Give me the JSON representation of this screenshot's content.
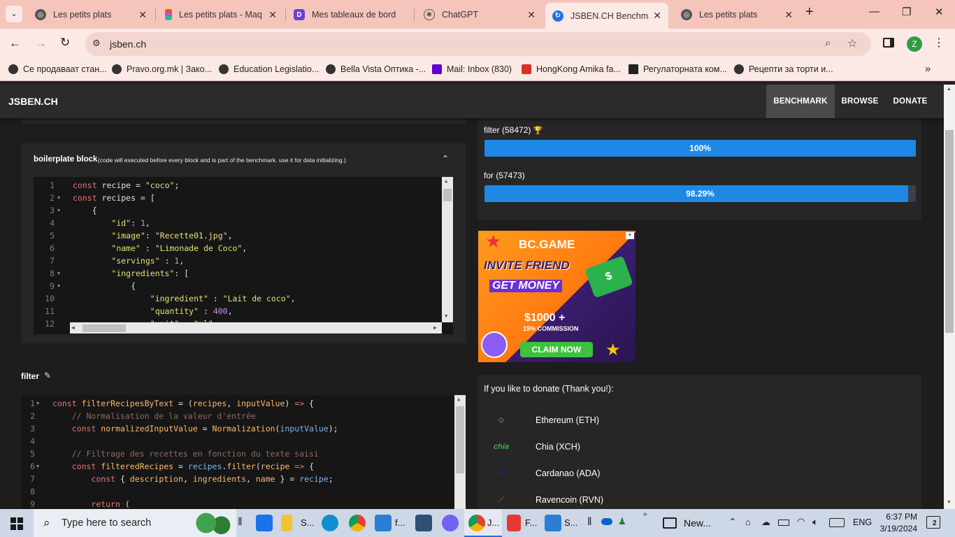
{
  "tabs": [
    {
      "title": "Les petits plats",
      "icon": "globe-icon"
    },
    {
      "title": "Les petits plats - Maq",
      "icon": "figma-icon"
    },
    {
      "title": "Mes tableaux de bord",
      "icon": "dashboard-icon"
    },
    {
      "title": "ChatGPT",
      "icon": "chatgpt-icon"
    },
    {
      "title": "JSBEN.CH Benchmark",
      "icon": "jsben-icon"
    },
    {
      "title": "Les petits plats",
      "icon": "globe-icon"
    }
  ],
  "address": "jsben.ch",
  "profile_initial": "Z",
  "bookmarks": [
    "Се продаваат стан...",
    "Pravo.org.mk | Зако...",
    "Education Legislatio...",
    "Bella Vista Оптика -...",
    "Mail: Inbox (830)",
    "HongKong Amika fa...",
    "Регулаторната ком...",
    "Рецепти за торти и..."
  ],
  "site": {
    "brand": "JSBEN.CH",
    "nav": [
      "BENCHMARK",
      "BROWSE",
      "DONATE"
    ]
  },
  "boilerplate": {
    "title": "boilerplate block",
    "hint": "(code will executed before every block and is part of the benchmark. use it for data initializing.)"
  },
  "filter_block": {
    "title": "filter"
  },
  "results": [
    {
      "label": "filter (58472)",
      "percent_text": "100%",
      "percent": 100,
      "trophy": true
    },
    {
      "label": "for (57473)",
      "percent_text": "98.29%",
      "percent": 98.29,
      "trophy": false
    }
  ],
  "ad": {
    "brand": "BC.GAME",
    "line1": "INVITE FRIEND",
    "line2": "GET MONEY",
    "amount": "$1000 +",
    "commission": "15% COMMISSION",
    "cta": "CLAIM NOW"
  },
  "donate": {
    "heading": "If you like to donate (Thank you!):",
    "coins": [
      {
        "name": "Ethereum (ETH)",
        "icon": "ethereum-icon"
      },
      {
        "name": "Chia (XCH)",
        "icon": "chia-icon"
      },
      {
        "name": "Cardanao (ADA)",
        "icon": "cardano-icon"
      },
      {
        "name": "Ravencoin (RVN)",
        "icon": "ravencoin-icon"
      }
    ]
  },
  "taskbar": {
    "search_placeholder": "Type here to search",
    "items": [
      "S...",
      "f...",
      "J...",
      "F...",
      "S...",
      "New..."
    ],
    "lang": "ENG",
    "time": "6:37 PM",
    "date": "3/19/2024",
    "notif_count": "2"
  },
  "colors": {
    "accent": "#1e88e5",
    "tabstrip": "#f5c5bc",
    "site_bg": "#1d1d1d"
  }
}
